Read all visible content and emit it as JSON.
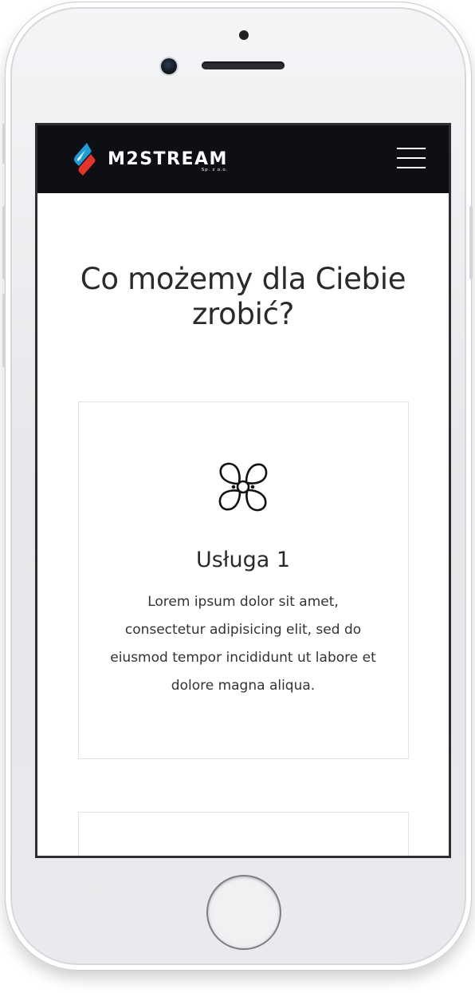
{
  "brand": {
    "name": "M2STREAM",
    "suffix": "Sp. z o.o.",
    "colors": {
      "blue": "#1f9bd7",
      "red": "#e5332a",
      "nav_bg": "#0d0f14"
    }
  },
  "nav": {
    "menu_icon": "hamburger-menu-icon"
  },
  "section": {
    "title": "Co możemy dla Ciebie zrobić?"
  },
  "services": [
    {
      "icon": "fan-icon",
      "title": "Usługa 1",
      "description": "Lorem ipsum dolor sit amet, consectetur adipisicing elit, sed do eiusmod tempor incididunt ut labore et dolore magna aliqua."
    }
  ]
}
